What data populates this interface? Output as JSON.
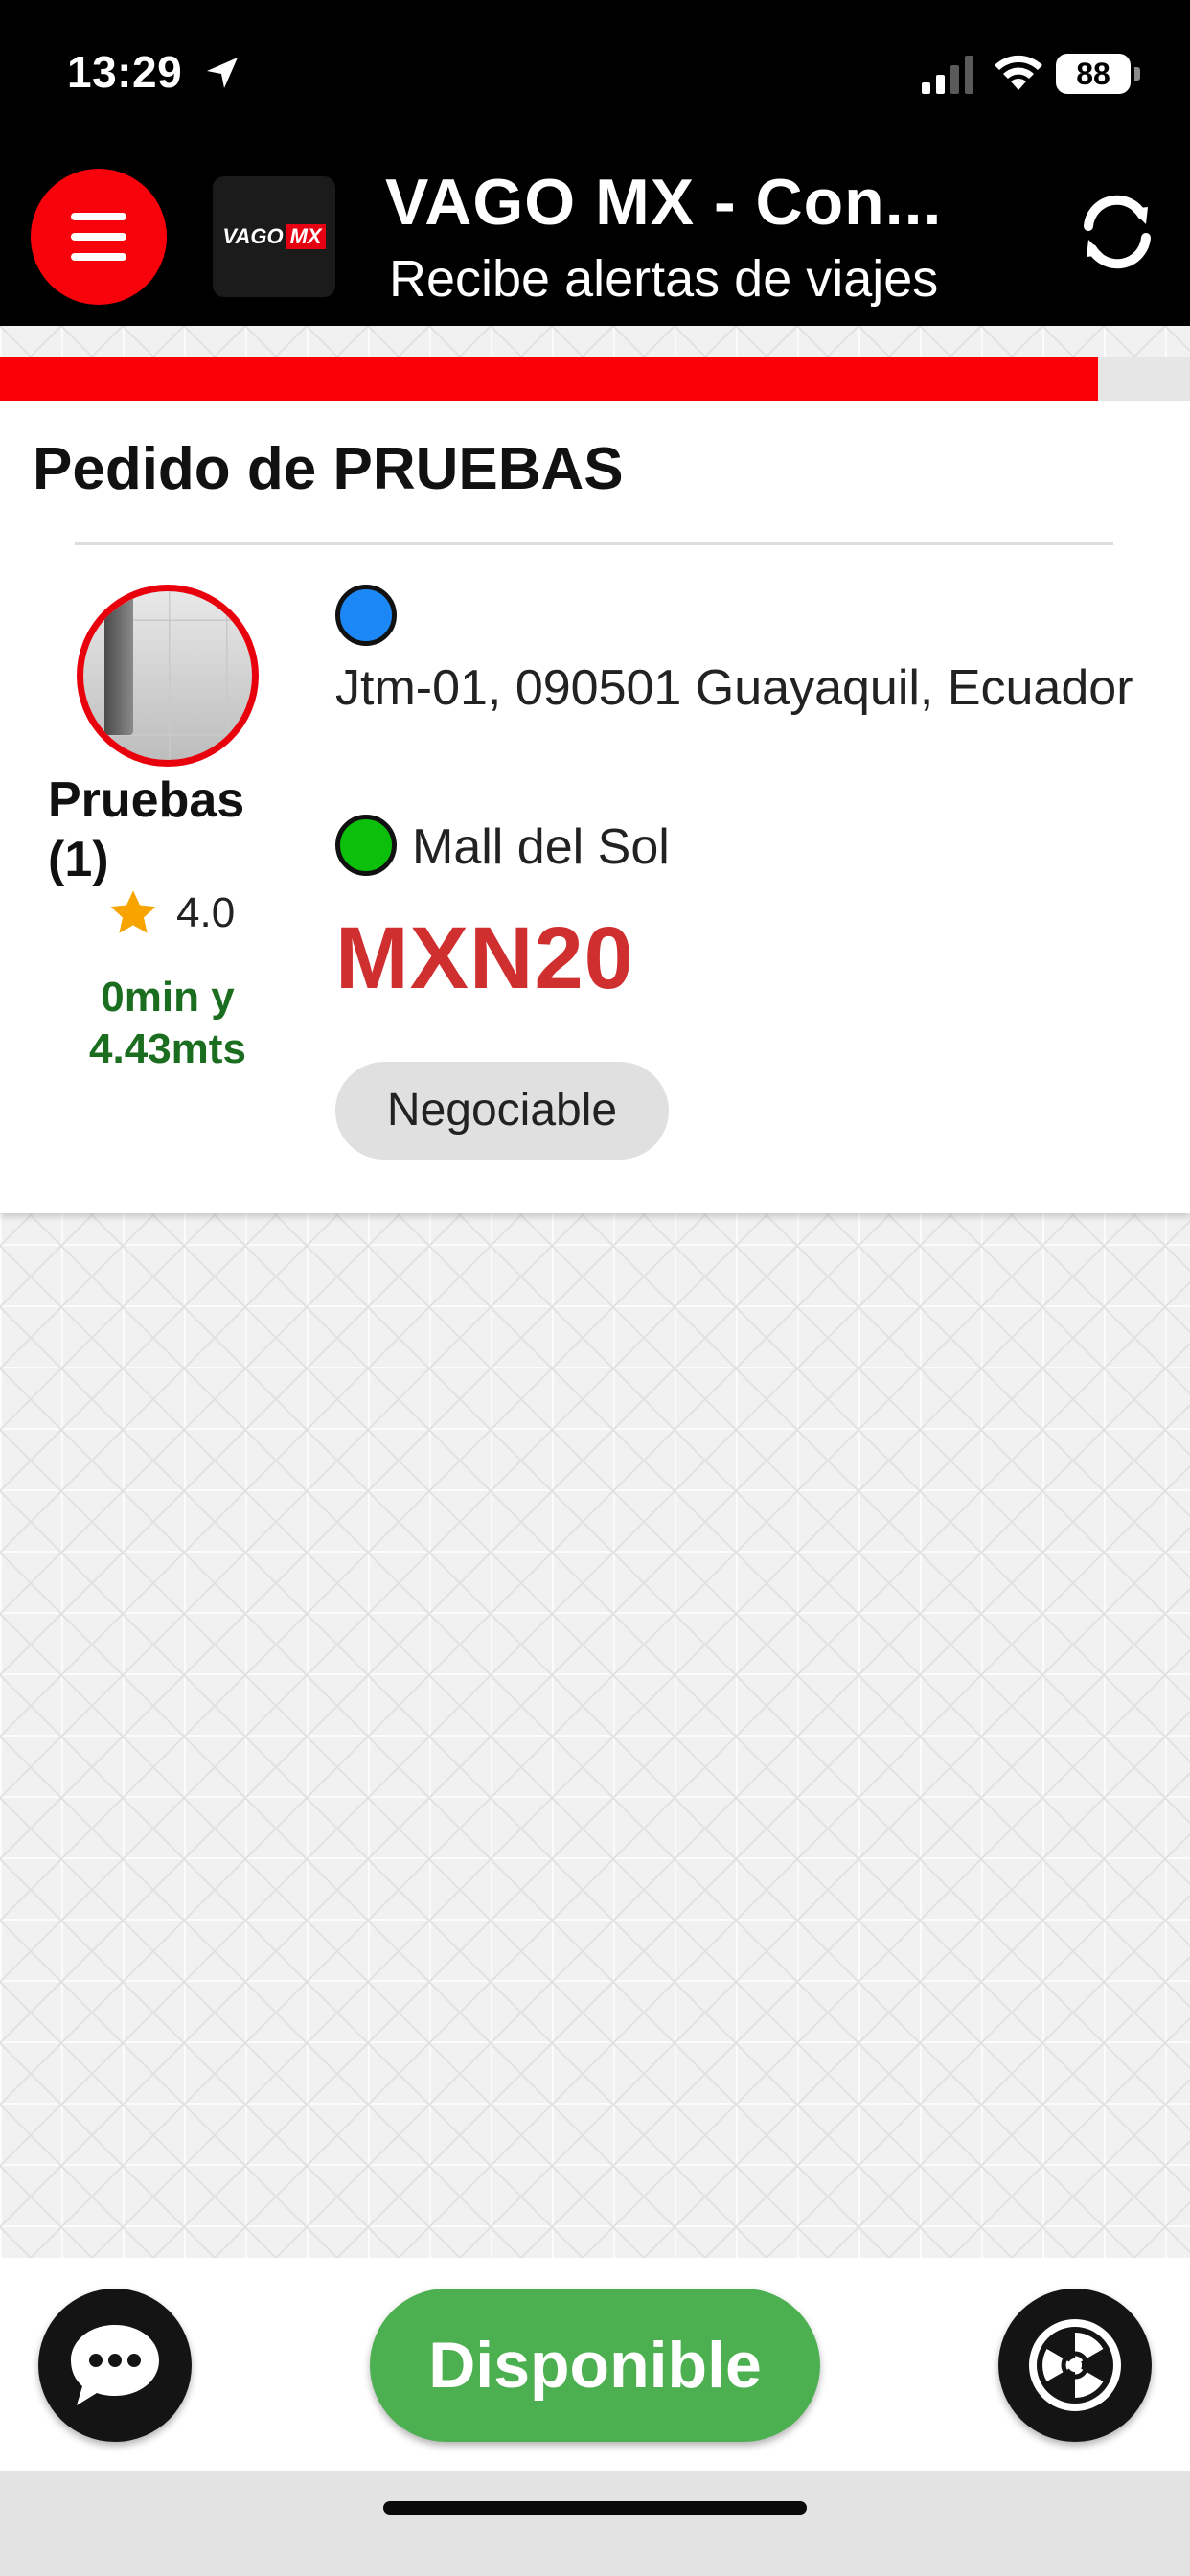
{
  "status_bar": {
    "time": "13:29",
    "battery": "88",
    "icons": [
      "location-arrow-icon",
      "signal-icon",
      "wifi-icon",
      "battery-icon"
    ]
  },
  "header": {
    "logo_text": "VAGO",
    "logo_accent": "MX",
    "title": "VAGO MX - Con...",
    "subtitle": "Recibe alertas de viajes",
    "menu_icon": "hamburger-icon",
    "refresh_icon": "refresh-icon"
  },
  "progress": {
    "fraction": 0.923,
    "color": "#fc0008"
  },
  "order": {
    "title": "Pedido de PRUEBAS",
    "driver_name": "Pruebas (1)",
    "rating": "4.0",
    "eta": "0min y 4.43mts",
    "origin": "Jtm-01, 090501 Guayaquil, Ecuador",
    "destination": "Mall del Sol",
    "price": "MXN20",
    "tag": "Negociable"
  },
  "bottom": {
    "chat_icon": "chat-icon",
    "available_label": "Disponible",
    "radar_icon": "radiation-icon"
  },
  "colors": {
    "accent_red": "#f8030b",
    "price_red": "#d02f2f",
    "eta_green": "#1b6e1f",
    "available_green": "#4caf50",
    "origin_dot": "#1c88f7",
    "dest_dot": "#0bbf0b"
  }
}
